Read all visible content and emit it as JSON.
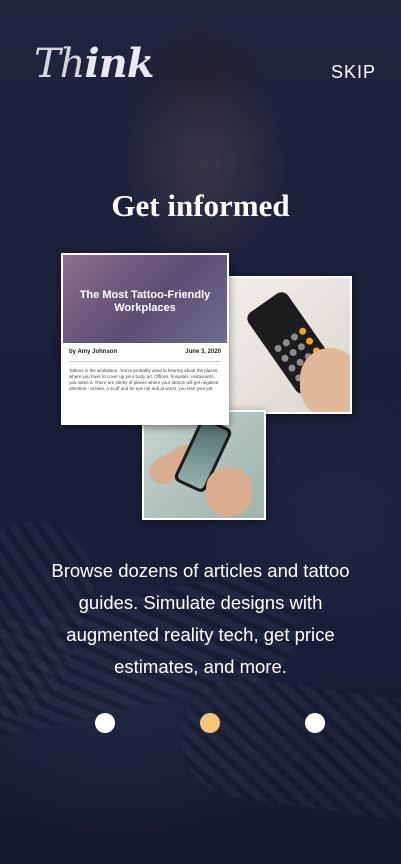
{
  "header": {
    "logo_thin": "Th",
    "logo_bold": "ink",
    "skip_label": "SKIP"
  },
  "heading": "Get informed",
  "cards": {
    "article": {
      "title": "The Most Tattoo-Friendly Workplaces",
      "author": "by Amy Johnson",
      "date": "June 3, 2020",
      "body": "Tattoos in the workplace. You're probably used to hearing about the places where you have to cover up your body art. Offices, hospitals, restaurants, you name it. There are plenty of places where your tattoos will get negative attention - at best, a scoff and an eye roll and at worst, you lose your job."
    }
  },
  "description": "Browse dozens of articles and tattoo guides. Simulate designs with augmented reality tech, get price estimates, and more.",
  "pagination": {
    "current": 2,
    "total": 3,
    "active_color": "#f5c57a",
    "inactive_color": "#ffffff"
  }
}
